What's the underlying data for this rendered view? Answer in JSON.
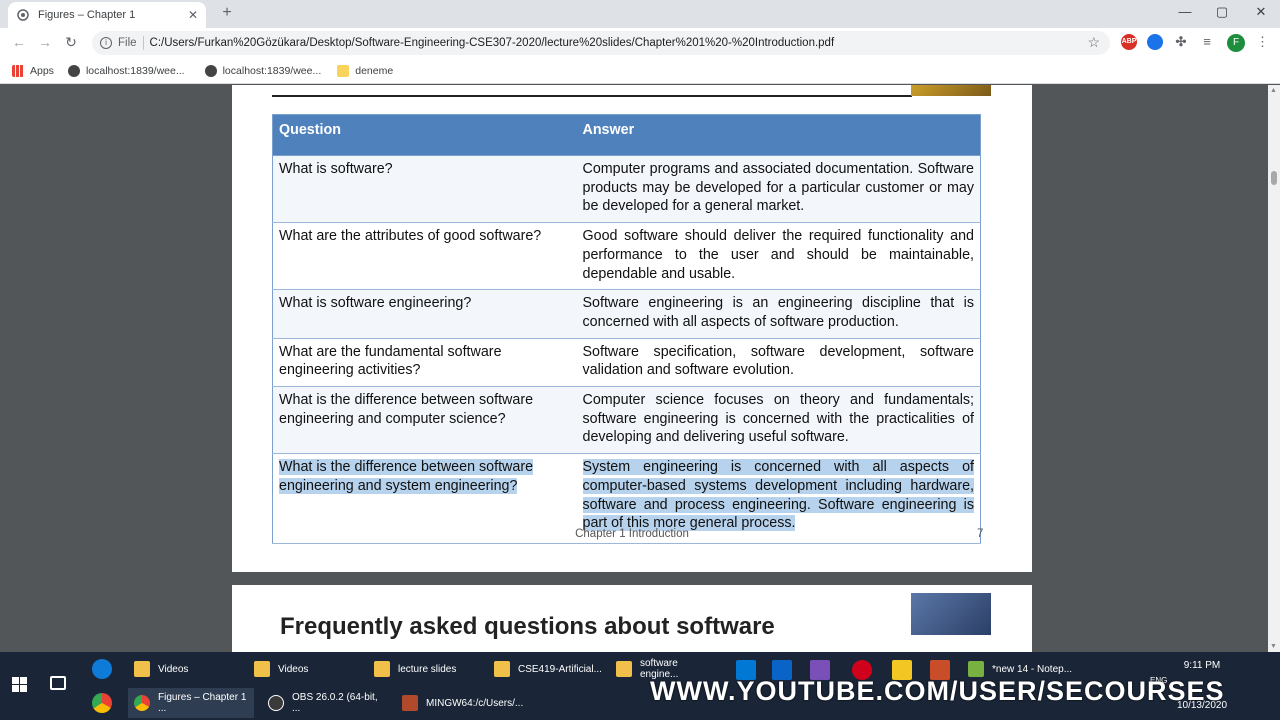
{
  "browser": {
    "tab_title": "Figures – Chapter 1",
    "url_scheme": "File",
    "url": "C:/Users/Furkan%20Gözükara/Desktop/Software-Engineering-CSE307-2020/lecture%20slides/Chapter%201%20-%20Introduction.pdf",
    "profile_initial": "F",
    "extensions": [
      "ABP"
    ]
  },
  "bookmarks": [
    {
      "label": "Apps"
    },
    {
      "label": "localhost:1839/wee..."
    },
    {
      "label": "localhost:1839/wee..."
    },
    {
      "label": "deneme"
    }
  ],
  "table": {
    "header_q": "Question",
    "header_a": "Answer",
    "rows": [
      {
        "q": "What is software?",
        "a": "Computer programs and associated documentation. Software products may be developed for a particular customer or may be developed for a general market."
      },
      {
        "q": "What are the attributes of good software?",
        "a": "Good software should deliver the required functionality and performance to the user and should be maintainable, dependable and usable."
      },
      {
        "q": "What is software engineering?",
        "a": "Software engineering is an engineering discipline that is concerned with all aspects of software production."
      },
      {
        "q": "What are the fundamental software engineering activities?",
        "a": "Software specification, software development, software validation and software evolution."
      },
      {
        "q": "What is the difference between software engineering and computer science?",
        "a": "Computer science focuses on theory and fundamentals; software engineering is concerned with the practicalities of developing and delivering useful software."
      },
      {
        "q": "What is the difference between software engineering and system engineering?",
        "a": "System engineering is concerned with all aspects of computer-based systems development including hardware, software and process engineering. Software engineering is part of this more general process."
      }
    ]
  },
  "footer": {
    "label": "Chapter 1  Introduction",
    "page": "7"
  },
  "next_page_title": "Frequently asked questions about software",
  "taskbar": {
    "row1": [
      "Videos",
      "Videos",
      "lecture slides",
      "CSE419-Artificial...",
      "software engine...",
      "*new 14 - Notep..."
    ],
    "row2": [
      "Figures – Chapter 1 ...",
      "OBS 26.0.2 (64-bit, ...",
      "MINGW64:/c/Users/..."
    ],
    "time": "9:11 PM",
    "date": "10/13/2020",
    "lang": "ENG"
  },
  "watermark": "WWW.YOUTUBE.COM/USER/SECOURSES"
}
